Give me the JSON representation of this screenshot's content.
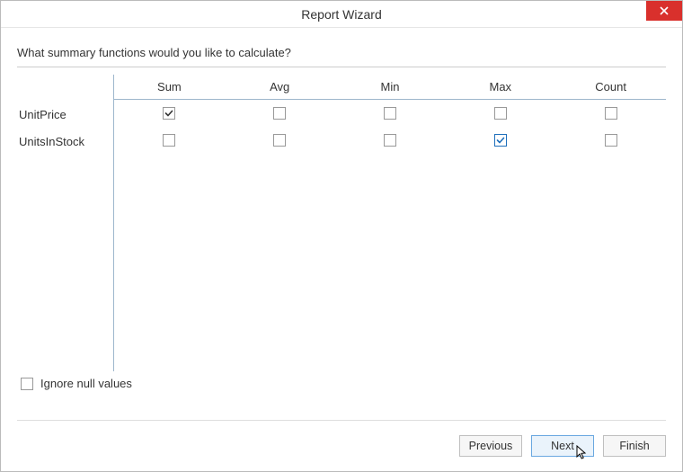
{
  "window": {
    "title": "Report Wizard"
  },
  "prompt": "What summary functions would you like to calculate?",
  "columns": [
    "Sum",
    "Avg",
    "Min",
    "Max",
    "Count"
  ],
  "rows": [
    {
      "label": "UnitPrice",
      "checks": [
        true,
        false,
        false,
        false,
        false
      ],
      "style": [
        "dark",
        "",
        "",
        "",
        ""
      ]
    },
    {
      "label": "UnitsInStock",
      "checks": [
        false,
        false,
        false,
        true,
        false
      ],
      "style": [
        "",
        "",
        "",
        "accent",
        ""
      ]
    }
  ],
  "ignore": {
    "label": "Ignore null values",
    "checked": false
  },
  "buttons": {
    "previous": "Previous",
    "next": "Next",
    "finish": "Finish"
  }
}
